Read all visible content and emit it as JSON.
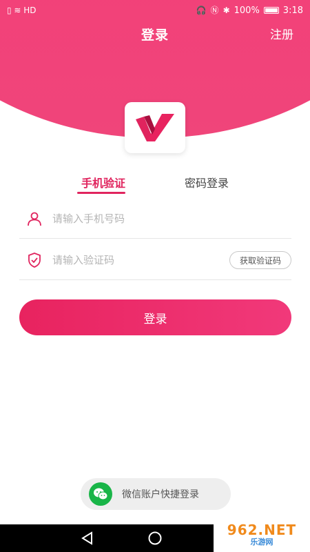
{
  "status_bar": {
    "left_glyphs": "▯ ≋ HD",
    "battery_percent": "100%",
    "time": "3:18"
  },
  "header": {
    "title": "登录",
    "register_label": "注册"
  },
  "tabs": [
    {
      "label": "手机验证",
      "active": true
    },
    {
      "label": "密码登录",
      "active": false
    }
  ],
  "form": {
    "phone_placeholder": "请输入手机号码",
    "code_placeholder": "请输入验证码",
    "get_code_label": "获取验证码",
    "login_label": "登录"
  },
  "wechat": {
    "label": "微信账户快捷登录"
  },
  "watermark": {
    "brand": "962.NET",
    "sub": "乐游网"
  },
  "colors": {
    "brand": "#e8235f",
    "wechat": "#19b548"
  },
  "icons": {
    "user": "user-icon",
    "shield": "shield-check-icon",
    "wechat": "wechat-icon",
    "back": "back-triangle-icon",
    "home": "home-circle-icon"
  }
}
